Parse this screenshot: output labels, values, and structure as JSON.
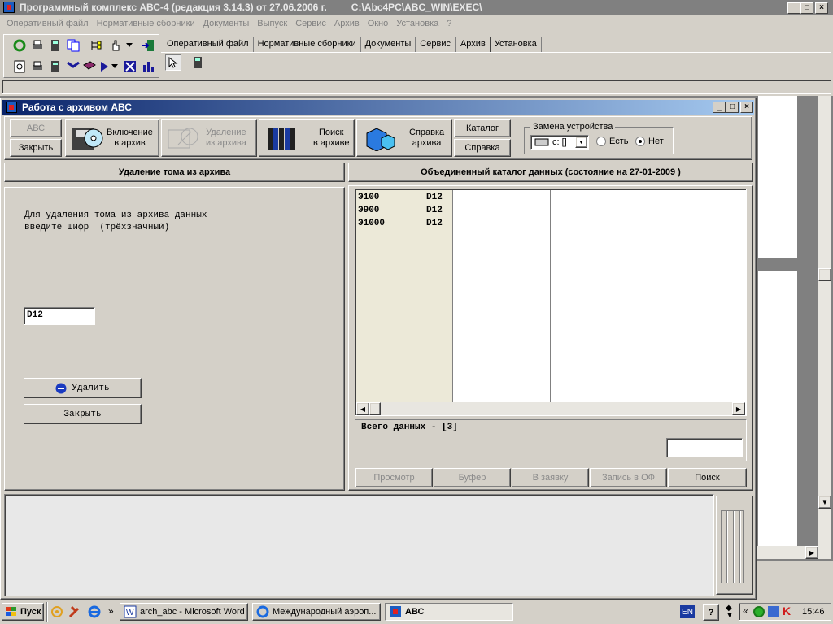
{
  "app": {
    "title": "Программный комплекс АВС-4 (редакция 3.14.3) от 27.06.2006 г.",
    "path": "C:\\Abc4PC\\ABC_WIN\\EXEC\\",
    "menu": [
      "Оперативный файл",
      "Нормативные сборники",
      "Документы",
      "Выпуск",
      "Сервис",
      "Архив",
      "Окно",
      "Установка",
      "?"
    ],
    "tabs": [
      "Оперативный файл",
      "Нормативные сборники",
      "Документы",
      "Сервис",
      "Архив",
      "Установка"
    ],
    "active_tab": "Архив"
  },
  "dialog": {
    "title": "Работа с архивом АВС",
    "toolbar": {
      "abc": "АВС",
      "close": "Закрыть",
      "include_l1": "Включение",
      "include_l2": "в архив",
      "delete_l1": "Удаление",
      "delete_l2": "из архива",
      "search_l1": "Поиск",
      "search_l2": "в архиве",
      "help_l1": "Справка",
      "help_l2": "архива",
      "catalog": "Каталог",
      "help": "Справка",
      "device_group": "Замена устройства",
      "device_value": "c: []",
      "radio_yes": "Есть",
      "radio_no": "Нет",
      "radio_selected": "Нет"
    },
    "left": {
      "header": "Удаление тома из архива",
      "instruction_l1": "Для удаления тома из архива данных",
      "instruction_l2": "введите шифр  (трёхзначный)",
      "code_value": "D12",
      "delete_button": "Удалить",
      "close_button": "Закрыть"
    },
    "right": {
      "header": "Объединенный каталог данных (состояние на 27-01-2009 )",
      "catalog": [
        {
          "name": "Э100",
          "code": "D12"
        },
        {
          "name": "Э900",
          "code": "D12"
        },
        {
          "name": "Э1000",
          "code": "D12"
        }
      ],
      "total": "Всего данных - [3]",
      "buttons": [
        "Просмотр",
        "Буфер",
        "В заявку",
        "Запись в ОФ",
        "Поиск"
      ]
    }
  },
  "taskbar": {
    "start": "Пуск",
    "items": [
      "arch_abc - Microsoft Word",
      "Международный аэроп...",
      "АВС"
    ],
    "lang": "EN",
    "time": "15:46"
  },
  "colors": {
    "title_active": "#0a246a",
    "title_active_end": "#a6caf0",
    "title_inactive": "#808080",
    "face": "#d4d0c8"
  }
}
